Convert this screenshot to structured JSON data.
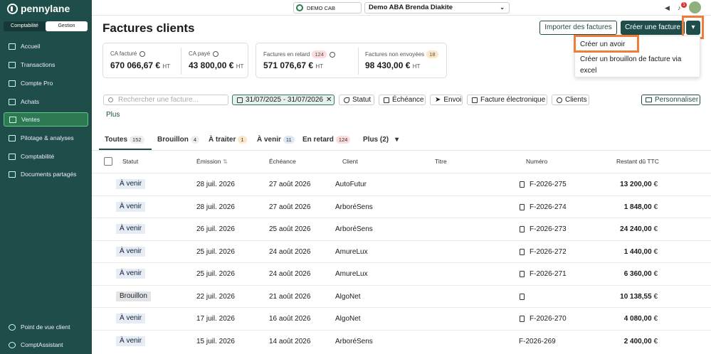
{
  "brand": "pennylane",
  "mode_toggle": {
    "left": "Comptabilité",
    "right": "Gestion"
  },
  "sidebar": {
    "items": [
      {
        "label": "Accueil",
        "icon": "grid-icon"
      },
      {
        "label": "Transactions",
        "icon": "bank-icon"
      },
      {
        "label": "Compte Pro",
        "icon": "card-icon"
      },
      {
        "label": "Achats",
        "icon": "cart-icon"
      },
      {
        "label": "Ventes",
        "icon": "sales-icon"
      },
      {
        "label": "Pilotage & analyses",
        "icon": "chart-icon"
      },
      {
        "label": "Comptabilité",
        "icon": "ledger-icon"
      },
      {
        "label": "Documents partagés",
        "icon": "folder-icon"
      }
    ],
    "bottom": [
      {
        "label": "Point de vue client",
        "icon": "eye-icon"
      },
      {
        "label": "ComptAssistant",
        "icon": "sparkle-icon"
      }
    ]
  },
  "topbar": {
    "cab": "DEMO CAB",
    "dossier": "Demo ABA Brenda Diakite",
    "notif_count": "1"
  },
  "page": {
    "title": "Factures clients",
    "import_btn": "Importer des factures",
    "create_btn": "Créer une facture",
    "caret": "▾"
  },
  "dropdown": {
    "items": [
      "Créer un avoir",
      "Créer un brouillon de facture via",
      "excel"
    ]
  },
  "kpi_left": [
    {
      "label": "CA facturé",
      "value": "670 066,67 €",
      "unit": "HT"
    },
    {
      "label": "CA payé",
      "value": "43 800,00 €",
      "unit": "HT"
    }
  ],
  "kpi_mid": {
    "label": "Factures en retard",
    "badge": "124",
    "value": "571 076,67 €",
    "unit": "HT"
  },
  "kpi_right": {
    "label": "Factures non envoyées",
    "badge": "18",
    "value": "98 430,00 €",
    "unit": "HT"
  },
  "filters": {
    "search_placeholder": "Rechercher une facture...",
    "date": "31/07/2025 - 31/07/2026",
    "statut": "Statut",
    "echeance": "Échéance",
    "envoi": "Envoi",
    "facture_elec": "Facture électronique",
    "clients": "Clients",
    "personnaliser": "Personnaliser",
    "plus": "Plus"
  },
  "tabs": [
    {
      "label": "Toutes",
      "count": "152"
    },
    {
      "label": "Brouillon",
      "count": "4"
    },
    {
      "label": "À traiter",
      "count": "1"
    },
    {
      "label": "À venir",
      "count": "11"
    },
    {
      "label": "En retard",
      "count": "124"
    },
    {
      "label": "Plus (2)",
      "count": ""
    }
  ],
  "table": {
    "headers": {
      "statut": "Statut",
      "emission": "Émission",
      "echeance": "Échéance",
      "client": "Client",
      "titre": "Titre",
      "numero": "Numéro",
      "restant": "Restant dû TTC"
    },
    "rows": [
      {
        "statut": "À venir",
        "emission": "28 juil. 2026",
        "echeance": "27 août 2026",
        "client": "AutoFutur",
        "numero": "F-2026-275",
        "restant": "13 200,00",
        "cur": "€"
      },
      {
        "statut": "À venir",
        "emission": "28 juil. 2026",
        "echeance": "27 août 2026",
        "client": "ArboréSens",
        "numero": "F-2026-274",
        "restant": "1 848,00",
        "cur": "€"
      },
      {
        "statut": "À venir",
        "emission": "26 juil. 2026",
        "echeance": "25 août 2026",
        "client": "ArboréSens",
        "numero": "F-2026-273",
        "restant": "24 240,00",
        "cur": "€"
      },
      {
        "statut": "À venir",
        "emission": "25 juil. 2026",
        "echeance": "24 août 2026",
        "client": "AmureLux",
        "numero": "F-2026-272",
        "restant": "1 440,00",
        "cur": "€"
      },
      {
        "statut": "À venir",
        "emission": "25 juil. 2026",
        "echeance": "24 août 2026",
        "client": "AmureLux",
        "numero": "F-2026-271",
        "restant": "6 360,00",
        "cur": "€"
      },
      {
        "statut": "Brouillon",
        "emission": "22 juil. 2026",
        "echeance": "21 août 2026",
        "client": "AlgoNet",
        "numero": "",
        "restant": "10 138,55",
        "cur": "€"
      },
      {
        "statut": "À venir",
        "emission": "17 juil. 2026",
        "echeance": "16 août 2026",
        "client": "AlgoNet",
        "numero": "F-2026-270",
        "restant": "4 080,00",
        "cur": "€"
      },
      {
        "statut": "À venir",
        "emission": "15 juil. 2026",
        "echeance": "14 août 2026",
        "client": "ArboréSens",
        "numero": "F-2026-269",
        "restant": "2 400,00",
        "cur": "€"
      }
    ]
  },
  "colors": {
    "sidebar": "#1f4d4a",
    "accent": "#2d7a52",
    "highlight": "#ee7c3a"
  }
}
